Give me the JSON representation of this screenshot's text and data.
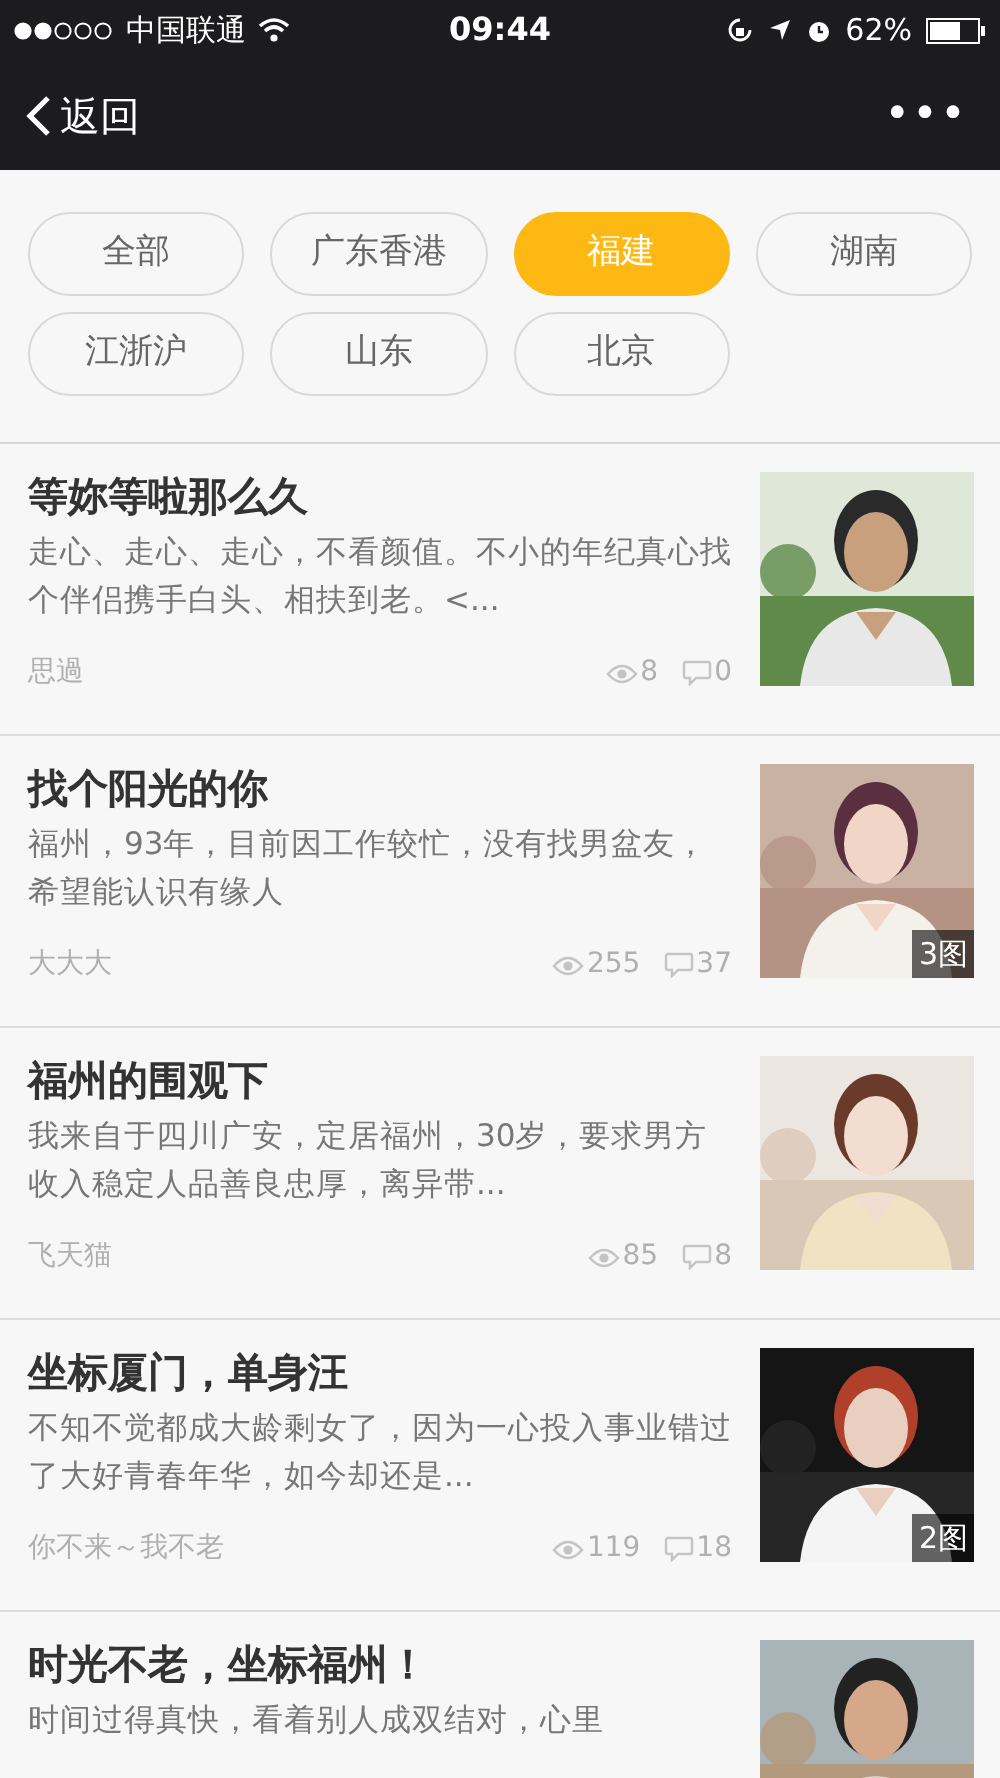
{
  "status_bar": {
    "carrier": "中国联通",
    "time": "09:44",
    "battery": "62%"
  },
  "nav_bar": {
    "back": "返回",
    "more": "•••"
  },
  "filters": [
    {
      "label": "全部",
      "selected": false
    },
    {
      "label": "广东香港",
      "selected": false
    },
    {
      "label": "福建",
      "selected": true
    },
    {
      "label": "湖南",
      "selected": false
    },
    {
      "label": "江浙沪",
      "selected": false
    },
    {
      "label": "山东",
      "selected": false
    },
    {
      "label": "北京",
      "selected": false
    }
  ],
  "posts": [
    {
      "title": "等妳等啦那么久",
      "text": "走心、走心、走心，不看颜值。不小的年纪真心找个伴侣携手白头、相扶到老。<...",
      "author": "思過",
      "views": "8",
      "comments": "0"
    },
    {
      "title": "找个阳光的你",
      "text": "福州，93年，目前因工作较忙，没有找男盆友，希望能认识有缘人",
      "author": "大大大",
      "views": "255",
      "comments": "37",
      "photo_count": "3图"
    },
    {
      "title": "福州的围观下",
      "text": "我来自于四川广安，定居福州，30岁，要求男方收入稳定人品善良忠厚，离异带...",
      "author": "飞天猫",
      "views": "85",
      "comments": "8"
    },
    {
      "title": "坐标厦门，单身汪",
      "text": "不知不觉都成大龄剩女了，因为一心投入事业错过了大好青春年华，如今却还是...",
      "author": "你不来～我不老",
      "views": "119",
      "comments": "18",
      "photo_count": "2图"
    },
    {
      "title": "时光不老，坐标福州！",
      "text": "时间过得真快，看着别人成双结对，心里"
    }
  ]
}
